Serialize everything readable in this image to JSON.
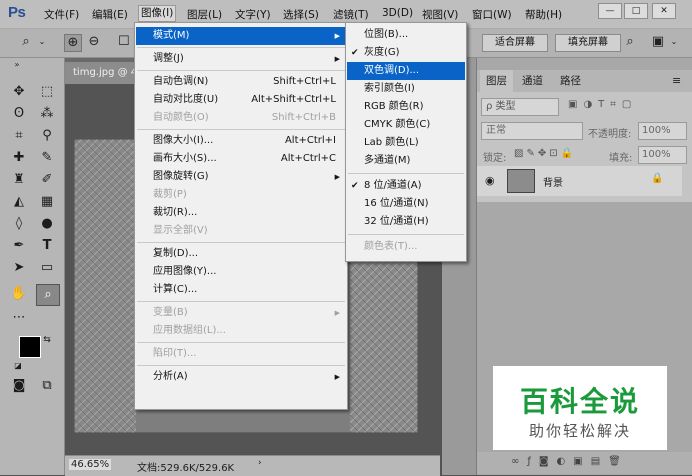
{
  "app": {
    "logo": "Ps"
  },
  "menubar": {
    "items": [
      "文件(F)",
      "编辑(E)",
      "图像(I)",
      "图层(L)",
      "文字(Y)",
      "选择(S)",
      "滤镜(T)",
      "3D(D)",
      "视图(V)",
      "窗口(W)",
      "帮助(H)"
    ],
    "active": "图像(I)"
  },
  "options": {
    "fit_screen": "适合屏幕",
    "fill_screen": "填充屏幕"
  },
  "document": {
    "tab_title": "timg.jpg @ 4",
    "zoom": "46.65%",
    "doc_info": "文档:529.6K/529.6K"
  },
  "image_menu": [
    {
      "label": "模式(M)",
      "shortcut": "",
      "submenu": true,
      "highlighted": true,
      "disabled": false
    },
    {
      "sep": true
    },
    {
      "label": "调整(J)",
      "shortcut": "",
      "submenu": true,
      "disabled": false
    },
    {
      "sep": true
    },
    {
      "label": "自动色调(N)",
      "shortcut": "Shift+Ctrl+L",
      "disabled": false
    },
    {
      "label": "自动对比度(U)",
      "shortcut": "Alt+Shift+Ctrl+L",
      "disabled": false
    },
    {
      "label": "自动颜色(O)",
      "shortcut": "Shift+Ctrl+B",
      "disabled": true
    },
    {
      "sep": true
    },
    {
      "label": "图像大小(I)...",
      "shortcut": "Alt+Ctrl+I",
      "disabled": false
    },
    {
      "label": "画布大小(S)...",
      "shortcut": "Alt+Ctrl+C",
      "disabled": false
    },
    {
      "label": "图像旋转(G)",
      "shortcut": "",
      "submenu": true,
      "disabled": false
    },
    {
      "label": "裁剪(P)",
      "shortcut": "",
      "disabled": true
    },
    {
      "label": "裁切(R)...",
      "shortcut": "",
      "disabled": false
    },
    {
      "label": "显示全部(V)",
      "shortcut": "",
      "disabled": true
    },
    {
      "sep": true
    },
    {
      "label": "复制(D)...",
      "shortcut": "",
      "disabled": false
    },
    {
      "label": "应用图像(Y)...",
      "shortcut": "",
      "disabled": false
    },
    {
      "label": "计算(C)...",
      "shortcut": "",
      "disabled": false
    },
    {
      "sep": true
    },
    {
      "label": "变量(B)",
      "shortcut": "",
      "submenu": true,
      "disabled": true
    },
    {
      "label": "应用数据组(L)...",
      "shortcut": "",
      "disabled": true
    },
    {
      "sep": true
    },
    {
      "label": "陷印(T)...",
      "shortcut": "",
      "disabled": true
    },
    {
      "sep": true
    },
    {
      "label": "分析(A)",
      "shortcut": "",
      "submenu": true,
      "disabled": false
    }
  ],
  "mode_menu": [
    {
      "label": "位图(B)...",
      "checked": false,
      "disabled": false
    },
    {
      "label": "灰度(G)",
      "checked": true,
      "disabled": false
    },
    {
      "label": "双色调(D)...",
      "checked": false,
      "highlighted": true,
      "disabled": false
    },
    {
      "label": "索引颜色(I)",
      "checked": false,
      "disabled": false
    },
    {
      "label": "RGB 颜色(R)",
      "checked": false,
      "disabled": false
    },
    {
      "label": "CMYK 颜色(C)",
      "checked": false,
      "disabled": false
    },
    {
      "label": "Lab 颜色(L)",
      "checked": false,
      "disabled": false
    },
    {
      "label": "多通道(M)",
      "checked": false,
      "disabled": false
    },
    {
      "sep": true
    },
    {
      "label": "8 位/通道(A)",
      "checked": true,
      "disabled": false
    },
    {
      "label": "16 位/通道(N)",
      "checked": false,
      "disabled": false
    },
    {
      "label": "32 位/通道(H)",
      "checked": false,
      "disabled": false
    },
    {
      "sep": true
    },
    {
      "label": "颜色表(T)...",
      "checked": false,
      "disabled": true
    }
  ],
  "layers_panel": {
    "tabs": [
      "图层",
      "通道",
      "路径"
    ],
    "kind_label": "ρ 类型",
    "blend_mode": "正常",
    "opacity_label": "不透明度:",
    "opacity": "100%",
    "lock_label": "锁定:",
    "fill_label": "填充:",
    "fill": "100%",
    "layer_name": "背景"
  },
  "watermark": {
    "title": "百科全说",
    "subtitle": "助你轻松解决"
  },
  "colors": {
    "highlight": "#0a64c8",
    "watermark_green": "#1a9a3a"
  }
}
